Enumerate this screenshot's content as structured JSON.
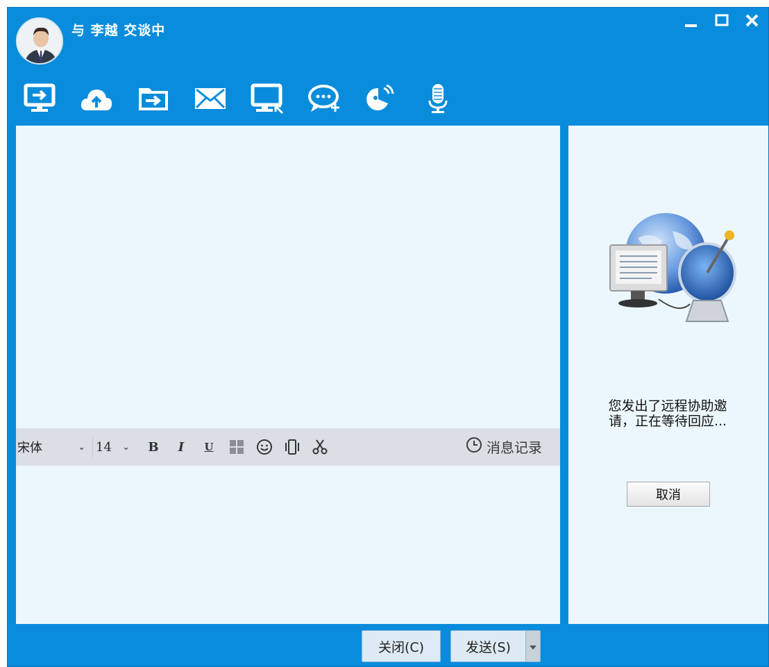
{
  "window": {
    "title": "与 李越 交谈中",
    "controls": [
      "minimize-icon",
      "maximize-icon",
      "close-icon"
    ]
  },
  "toolbar": {
    "tools": [
      {
        "name": "remote-desktop-icon"
      },
      {
        "name": "upload-cloud-icon"
      },
      {
        "name": "send-folder-icon"
      },
      {
        "name": "email-icon"
      },
      {
        "name": "screen-capture-icon"
      },
      {
        "name": "new-chat-icon"
      },
      {
        "name": "voice-call-icon"
      },
      {
        "name": "microphone-icon"
      }
    ]
  },
  "format_bar": {
    "font": "宋体",
    "size": "14",
    "bold": "B",
    "italic": "I",
    "underline": "U",
    "history_label": "消息记录"
  },
  "side_panel": {
    "wait_text": "您发出了远程协助邀请，正在等待回应...",
    "cancel_label": "取消"
  },
  "footer": {
    "close_label": "关闭(C)",
    "send_label": "发送(S)"
  },
  "colors": {
    "frame": "#0a8cdc",
    "pane": "#ebf7fd",
    "format_bar": "#d9dfe4"
  }
}
